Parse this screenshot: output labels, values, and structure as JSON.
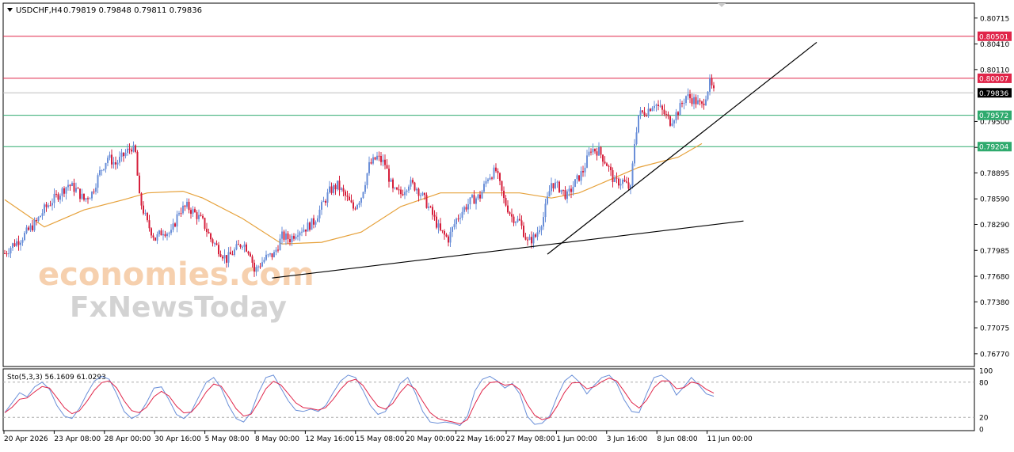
{
  "header": {
    "symbol": "USDCHF,H4",
    "ohlc": "0.79819 0.79848 0.79811 0.79836"
  },
  "watermark": {
    "line1": "economies.com",
    "line2": "FxNewsToday"
  },
  "chart_data": {
    "type": "candlestick",
    "price_axis": {
      "range": [
        0.7662,
        0.8089
      ],
      "ticks": [
        "0.80715",
        "0.80410",
        "0.80110",
        "0.79500",
        "0.79195",
        "0.78895",
        "0.78590",
        "0.78290",
        "0.77985",
        "0.77680",
        "0.77380",
        "0.77075",
        "0.76770"
      ]
    },
    "levels": [
      {
        "label": "0.80501",
        "value": 0.80501,
        "color": "#e0264a"
      },
      {
        "label": "0.80007",
        "value": 0.80007,
        "color": "#e0264a"
      },
      {
        "label": "0.79836",
        "value": 0.79836,
        "color": "#000000",
        "kind": "current"
      },
      {
        "label": "0.79572",
        "value": 0.79572,
        "color": "#2faa6e"
      },
      {
        "label": "0.79204",
        "value": 0.79204,
        "color": "#2faa6e"
      }
    ],
    "time_axis": {
      "labels": [
        "20 Apr 2026",
        "23 Apr 08:00",
        "28 Apr 00:00",
        "30 Apr 16:00",
        "5 May 08:00",
        "8 May 00:00",
        "12 May 16:00",
        "15 May 08:00",
        "20 May 00:00",
        "22 May 16:00",
        "27 May 08:00",
        "1 Jun 00:00",
        "3 Jun 16:00",
        "8 Jun 08:00",
        "11 Jun 00:00"
      ]
    },
    "price_path": [
      [
        0,
        0.7795
      ],
      [
        4,
        0.7805
      ],
      [
        8,
        0.7812
      ],
      [
        12,
        0.7822
      ],
      [
        16,
        0.7832
      ],
      [
        20,
        0.7847
      ],
      [
        24,
        0.7857
      ],
      [
        28,
        0.7866
      ],
      [
        32,
        0.7876
      ],
      [
        36,
        0.787
      ],
      [
        40,
        0.7858
      ],
      [
        44,
        0.7866
      ],
      [
        48,
        0.789
      ],
      [
        52,
        0.7908
      ],
      [
        56,
        0.79
      ],
      [
        60,
        0.791
      ],
      [
        64,
        0.792
      ],
      [
        66,
        0.7912
      ],
      [
        68,
        0.786
      ],
      [
        72,
        0.783
      ],
      [
        76,
        0.7812
      ],
      [
        80,
        0.7822
      ],
      [
        84,
        0.7818
      ],
      [
        88,
        0.7845
      ],
      [
        92,
        0.785
      ],
      [
        96,
        0.7842
      ],
      [
        100,
        0.7832
      ],
      [
        104,
        0.7812
      ],
      [
        108,
        0.78
      ],
      [
        112,
        0.7788
      ],
      [
        116,
        0.7798
      ],
      [
        120,
        0.7808
      ],
      [
        124,
        0.7796
      ],
      [
        126,
        0.7774
      ],
      [
        128,
        0.778
      ],
      [
        132,
        0.779
      ],
      [
        136,
        0.7794
      ],
      [
        140,
        0.7815
      ],
      [
        144,
        0.7812
      ],
      [
        148,
        0.7822
      ],
      [
        152,
        0.7825
      ],
      [
        156,
        0.7832
      ],
      [
        160,
        0.785
      ],
      [
        164,
        0.7868
      ],
      [
        168,
        0.7875
      ],
      [
        172,
        0.7862
      ],
      [
        176,
        0.7848
      ],
      [
        180,
        0.7862
      ],
      [
        184,
        0.7898
      ],
      [
        188,
        0.7908
      ],
      [
        192,
        0.79
      ],
      [
        196,
        0.7868
      ],
      [
        200,
        0.7865
      ],
      [
        204,
        0.7878
      ],
      [
        208,
        0.7872
      ],
      [
        212,
        0.7858
      ],
      [
        216,
        0.784
      ],
      [
        220,
        0.782
      ],
      [
        224,
        0.7812
      ],
      [
        228,
        0.7835
      ],
      [
        232,
        0.7848
      ],
      [
        236,
        0.7858
      ],
      [
        240,
        0.7862
      ],
      [
        244,
        0.7885
      ],
      [
        248,
        0.7892
      ],
      [
        252,
        0.7858
      ],
      [
        256,
        0.7838
      ],
      [
        260,
        0.7832
      ],
      [
        264,
        0.7808
      ],
      [
        268,
        0.7815
      ],
      [
        272,
        0.7838
      ],
      [
        276,
        0.7878
      ],
      [
        280,
        0.7872
      ],
      [
        284,
        0.7862
      ],
      [
        288,
        0.7878
      ],
      [
        292,
        0.7892
      ],
      [
        296,
        0.7918
      ],
      [
        300,
        0.7915
      ],
      [
        304,
        0.79
      ],
      [
        308,
        0.7878
      ],
      [
        312,
        0.788
      ],
      [
        316,
        0.787
      ],
      [
        318,
        0.7925
      ],
      [
        320,
        0.7958
      ],
      [
        324,
        0.7962
      ],
      [
        328,
        0.7972
      ],
      [
        332,
        0.7962
      ],
      [
        336,
        0.795
      ],
      [
        340,
        0.7962
      ],
      [
        344,
        0.798
      ],
      [
        348,
        0.7975
      ],
      [
        352,
        0.7968
      ],
      [
        356,
        0.7995
      ],
      [
        358,
        0.7984
      ]
    ],
    "ma_path": [
      [
        0,
        0.7858
      ],
      [
        20,
        0.7826
      ],
      [
        40,
        0.7846
      ],
      [
        60,
        0.7858
      ],
      [
        72,
        0.7866
      ],
      [
        90,
        0.7868
      ],
      [
        100,
        0.786
      ],
      [
        120,
        0.7836
      ],
      [
        140,
        0.7806
      ],
      [
        160,
        0.7808
      ],
      [
        180,
        0.782
      ],
      [
        200,
        0.785
      ],
      [
        220,
        0.7866
      ],
      [
        240,
        0.7866
      ],
      [
        260,
        0.7866
      ],
      [
        276,
        0.786
      ],
      [
        290,
        0.7866
      ],
      [
        304,
        0.788
      ],
      [
        320,
        0.7896
      ],
      [
        340,
        0.7908
      ],
      [
        352,
        0.7924
      ]
    ],
    "trendlines": [
      {
        "from": [
          135,
          0.7766
        ],
        "to": [
          373,
          0.7833
        ]
      },
      {
        "from": [
          274,
          0.7794
        ],
        "to": [
          410,
          0.8043
        ]
      }
    ],
    "stochastic": {
      "label": "Sto(5,3,3) 56.1609 61.0293",
      "range": [
        0,
        100
      ],
      "ticks": [
        "100",
        "80",
        "20",
        "0"
      ],
      "levels": [
        80,
        20
      ],
      "main_color": "#6a8fd8",
      "signal_color": "#e0264a",
      "values": [
        28,
        45,
        62,
        55,
        72,
        80,
        68,
        40,
        22,
        18,
        35,
        60,
        82,
        90,
        85,
        60,
        30,
        18,
        25,
        45,
        70,
        72,
        50,
        25,
        18,
        30,
        55,
        80,
        88,
        70,
        40,
        18,
        12,
        28,
        62,
        88,
        92,
        70,
        48,
        32,
        30,
        34,
        30,
        40,
        62,
        82,
        92,
        88,
        66,
        40,
        25,
        30,
        52,
        78,
        88,
        62,
        30,
        12,
        10,
        12,
        10,
        6,
        22,
        65,
        85,
        90,
        82,
        70,
        78,
        60,
        22,
        8,
        10,
        22,
        55,
        82,
        92,
        80,
        60,
        75,
        88,
        92,
        78,
        50,
        30,
        28,
        60,
        88,
        92,
        82,
        58,
        72,
        88,
        75,
        60,
        56
      ]
    }
  }
}
